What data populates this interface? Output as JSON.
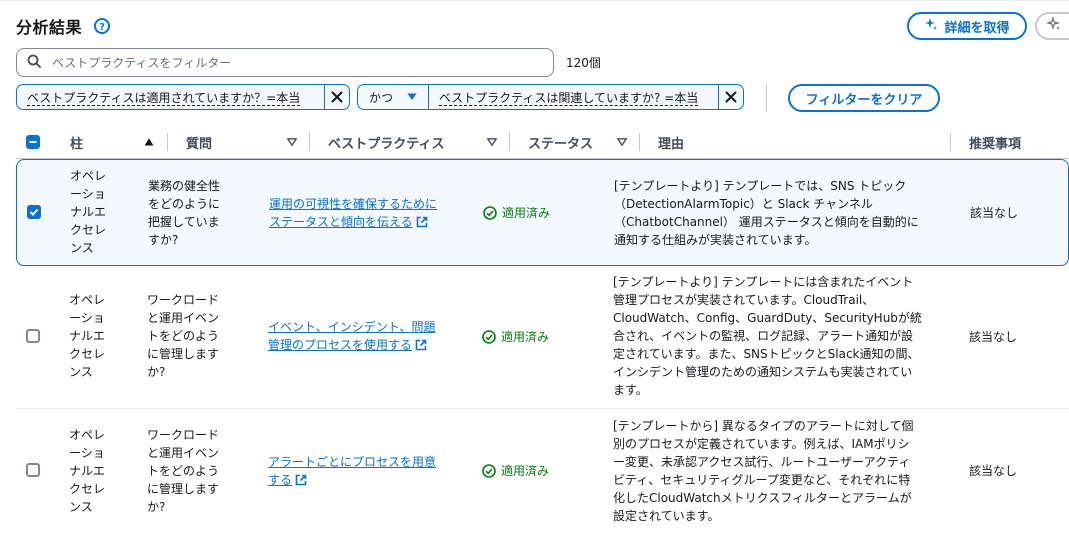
{
  "header": {
    "title": "分析結果",
    "details_button": "詳細を取得"
  },
  "search": {
    "placeholder": "ベストプラクティスをフィルター",
    "count": "120個"
  },
  "filters": {
    "token1": "ベストプラクティスは適用されていますか？=本当",
    "operator": "かつ",
    "token2": "ベストプラクティスは関連していますか? =本当",
    "clear_button": "フィルターをクリア"
  },
  "table": {
    "columns": {
      "pillar": "柱",
      "question": "質問",
      "best_practice": "ベストプラクティス",
      "status": "ステータス",
      "reason": "理由",
      "recommendation": "推奨事項"
    },
    "rows": [
      {
        "selected": true,
        "pillar": [
          "オペレ",
          "ーショ",
          "ナルエ",
          "クセレ",
          "ンス"
        ],
        "question": [
          "業務の健全性",
          "をどのように",
          "把握していま",
          "すか?"
        ],
        "best_practice": [
          "運用の可視性を確保するために",
          "ステータスと傾向を伝える"
        ],
        "status": "適用済み",
        "reason": [
          "[テンプレートより] テンプレートでは、SNS トピック",
          "（DetectionAlarmTopic）と Slack チャンネル",
          "（ChatbotChannel） 運用ステータスと傾向を自動的に",
          "通知する仕組みが実装されています。"
        ],
        "recommendation": "該当なし"
      },
      {
        "selected": false,
        "pillar": [
          "オペレ",
          "ーショ",
          "ナルエ",
          "クセレ",
          "ンス"
        ],
        "question": [
          "ワークロード",
          "と運用イベン",
          "トをどのよう",
          "に管理します",
          "か?"
        ],
        "best_practice": [
          "イベント、インシデント、問題",
          "管理のプロセスを使用する"
        ],
        "status": "適用済み",
        "reason": [
          "[テンプレートより] テンプレートには含まれたイベント",
          "管理プロセスが実装されています。CloudTrail、",
          "CloudWatch、Config、GuardDuty、SecurityHubが統",
          "合され、イベントの監視、ログ記録、アラート通知が設",
          "定されています。また、SNSトピックとSlack通知の間、",
          "インシデント管理のための通知システムも実装されてい",
          "ます。"
        ],
        "recommendation": "該当なし"
      },
      {
        "selected": false,
        "pillar": [
          "オペレ",
          "ーショ",
          "ナルエ",
          "クセレ",
          "ンス"
        ],
        "question": [
          "ワークロード",
          "と運用イベン",
          "トをどのよう",
          "に管理します",
          "か?"
        ],
        "best_practice": [
          "アラートごとにプロセスを用意",
          "する"
        ],
        "status": "適用済み",
        "reason": [
          "[テンプレートから] 異なるタイプのアラートに対して個",
          "別のプロセスが定義されています。例えば、IAMポリシ",
          "ー変更、未承認アクセス試行、ルートユーザーアクティ",
          "ビティ、セキュリティグループ変更など、それぞれに特",
          "化したCloudWatchメトリクスフィルターとアラームが",
          "設定されています。"
        ],
        "recommendation": "該当なし"
      }
    ]
  }
}
